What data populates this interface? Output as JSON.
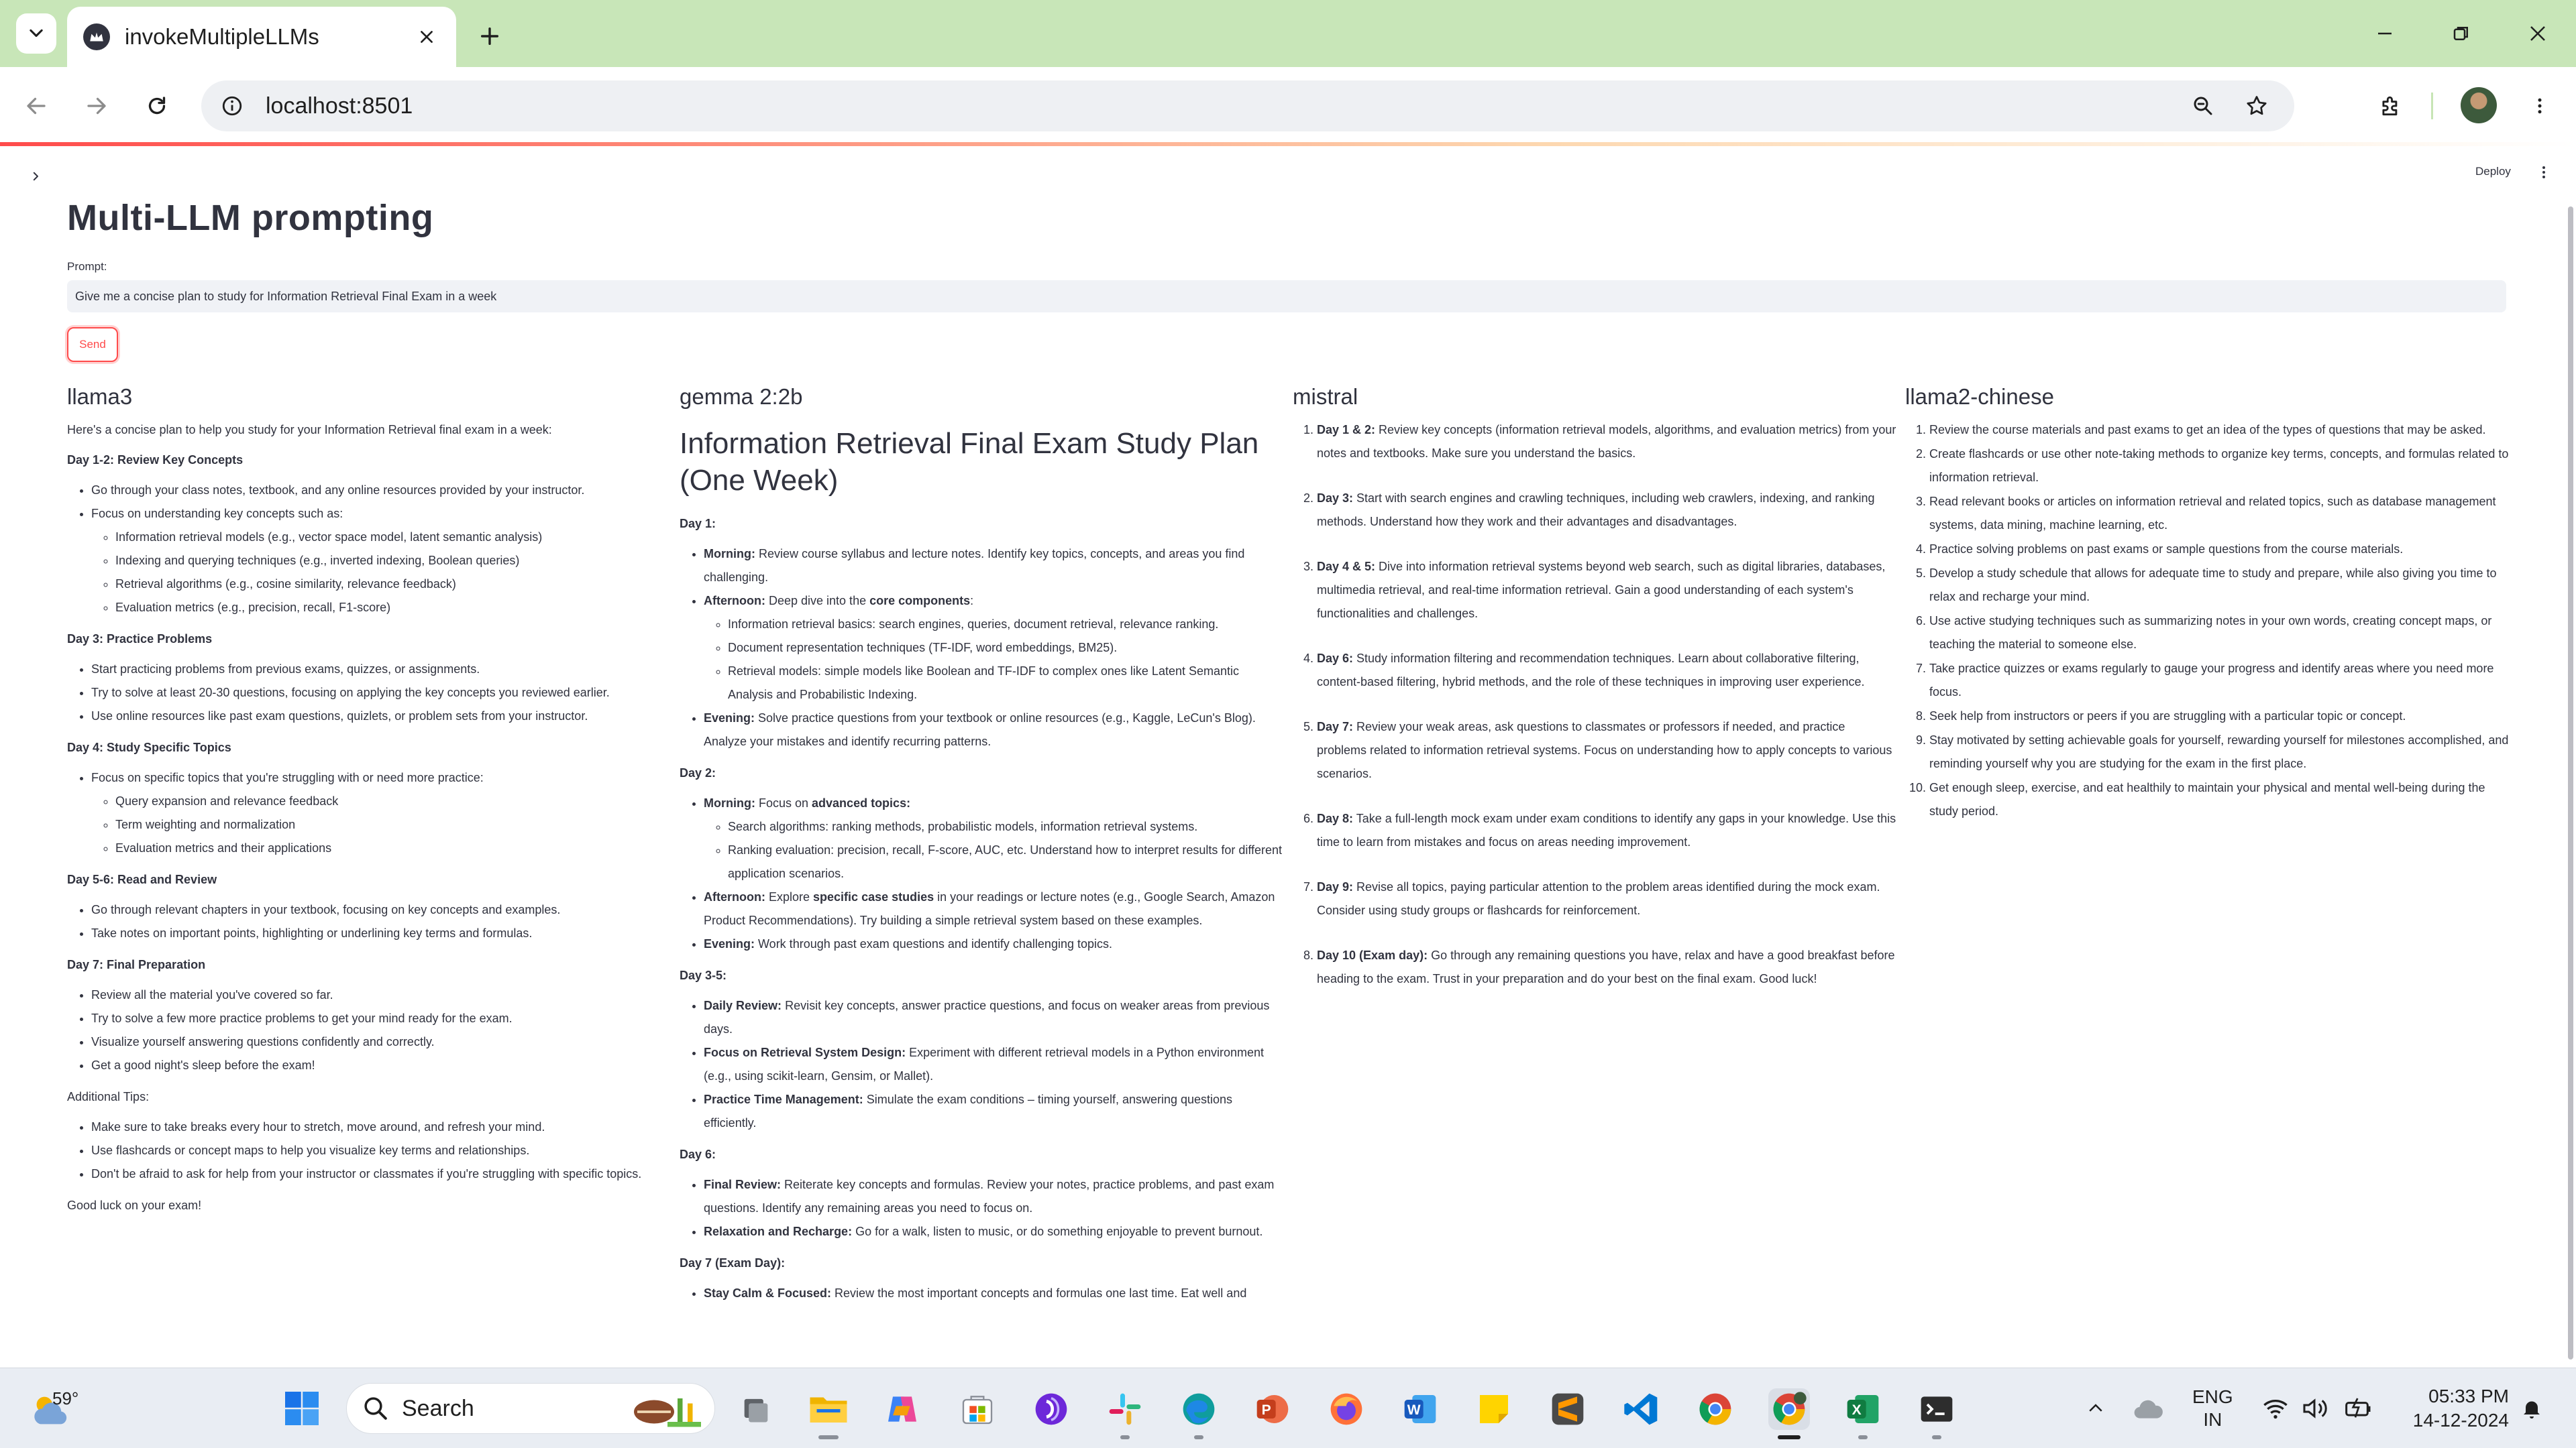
{
  "browser": {
    "tab_title": "invokeMultipleLLMs",
    "url": "localhost:8501"
  },
  "app": {
    "deploy_label": "Deploy",
    "title": "Multi-LLM prompting",
    "prompt_label": "Prompt:",
    "prompt_value": "Give me a concise plan to study for Information Retrieval Final Exam in a week",
    "send_label": "Send",
    "accent_color": "#ff4b4b"
  },
  "llama3": {
    "heading": "llama3",
    "intro": "Here's a concise plan to help you study for your Information Retrieval final exam in a week:",
    "day12": {
      "title": "Day 1-2: Review Key Concepts",
      "item1": "Go through your class notes, textbook, and any online resources provided by your instructor.",
      "item2": "Focus on understanding key concepts such as:",
      "sub": [
        "Information retrieval models (e.g., vector space model, latent semantic analysis)",
        "Indexing and querying techniques (e.g., inverted indexing, Boolean queries)",
        "Retrieval algorithms (e.g., cosine similarity, relevance feedback)",
        "Evaluation metrics (e.g., precision, recall, F1-score)"
      ]
    },
    "day3": {
      "title": "Day 3: Practice Problems",
      "items": [
        "Start practicing problems from previous exams, quizzes, or assignments.",
        "Try to solve at least 20-30 questions, focusing on applying the key concepts you reviewed earlier.",
        "Use online resources like past exam questions, quizlets, or problem sets from your instructor."
      ]
    },
    "day4": {
      "title": "Day 4: Study Specific Topics",
      "item1": "Focus on specific topics that you're struggling with or need more practice:",
      "sub": [
        "Query expansion and relevance feedback",
        "Term weighting and normalization",
        "Evaluation metrics and their applications"
      ]
    },
    "day56": {
      "title": "Day 5-6: Read and Review",
      "items": [
        "Go through relevant chapters in your textbook, focusing on key concepts and examples.",
        "Take notes on important points, highlighting or underlining key terms and formulas."
      ]
    },
    "day7": {
      "title": "Day 7: Final Preparation",
      "items": [
        "Review all the material you've covered so far.",
        "Try to solve a few more practice problems to get your mind ready for the exam.",
        "Visualize yourself answering questions confidently and correctly.",
        "Get a good night's sleep before the exam!"
      ]
    },
    "tips_title": "Additional Tips:",
    "tips": [
      "Make sure to take breaks every hour to stretch, move around, and refresh your mind.",
      "Use flashcards or concept maps to help you visualize key terms and relationships.",
      "Don't be afraid to ask for help from your instructor or classmates if you're struggling with specific topics."
    ],
    "closing": "Good luck on your exam!"
  },
  "gemma": {
    "heading": "gemma 2:2b",
    "plan_title": "Information Retrieval Final Exam Study Plan (One Week)",
    "day1_label": "Day 1:",
    "morning_label": "Morning:",
    "morning_text": " Review course syllabus and lecture notes. Identify key topics, concepts, and areas you find challenging.",
    "afternoon_label": "Afternoon:",
    "afternoon_pre": " Deep dive into the ",
    "afternoon_bold": "core components",
    "afternoon_post": ":",
    "afternoon_sub": [
      "Information retrieval basics: search engines, queries, document retrieval, relevance ranking.",
      "Document representation techniques (TF-IDF, word embeddings, BM25).",
      "Retrieval models: simple models like Boolean and TF-IDF to complex ones like Latent Semantic Analysis and Probabilistic Indexing."
    ],
    "evening_label": "Evening:",
    "evening_text": " Solve practice questions from your textbook or online resources (e.g., Kaggle, LeCun's Blog). Analyze your mistakes and identify recurring patterns.",
    "day2_label": "Day 2:",
    "d2_morning_pre": " Focus on ",
    "d2_morning_bold": "advanced topics:",
    "d2_morning_sub": [
      "Search algorithms: ranking methods, probabilistic models, information retrieval systems.",
      "Ranking evaluation: precision, recall, F-score, AUC, etc. Understand how to interpret results for different application scenarios."
    ],
    "d2_afternoon_pre": " Explore ",
    "d2_afternoon_bold": "specific case studies",
    "d2_afternoon_post": " in your readings or lecture notes (e.g., Google Search, Amazon Product Recommendations). Try building a simple retrieval system based on these examples.",
    "d2_evening_text": " Work through past exam questions and identify challenging topics.",
    "day35_label": "Day 3-5:",
    "daily_review_label": "Daily Review:",
    "daily_review_text": " Revisit key concepts, answer practice questions, and focus on weaker areas from previous days.",
    "focus_label": "Focus on Retrieval System Design:",
    "focus_text": " Experiment with different retrieval models in a Python environment (e.g., using scikit-learn, Gensim, or Mallet).",
    "ptm_label": "Practice Time Management:",
    "ptm_text": " Simulate the exam conditions – timing yourself, answering questions efficiently.",
    "day6_label": "Day 6:",
    "final_review_label": "Final Review:",
    "final_review_text": " Reiterate key concepts and formulas. Review your notes, practice problems, and past exam questions. Identify any remaining areas you need to focus on.",
    "relax_label": "Relaxation and Recharge:",
    "relax_text": " Go for a walk, listen to music, or do something enjoyable to prevent burnout.",
    "day7_label": "Day 7 (Exam Day):",
    "calm_label": "Stay Calm & Focused:",
    "calm_text": " Review the most important concepts and formulas one last time. Eat well and"
  },
  "mistral": {
    "heading": "mistral",
    "items": [
      {
        "label": "Day 1 & 2:",
        "text": " Review key concepts (information retrieval models, algorithms, and evaluation metrics) from your notes and textbooks. Make sure you understand the basics."
      },
      {
        "label": "Day 3:",
        "text": " Start with search engines and crawling techniques, including web crawlers, indexing, and ranking methods. Understand how they work and their advantages and disadvantages."
      },
      {
        "label": "Day 4 & 5:",
        "text": " Dive into information retrieval systems beyond web search, such as digital libraries, databases, multimedia retrieval, and real-time information retrieval. Gain a good understanding of each system's functionalities and challenges."
      },
      {
        "label": "Day 6:",
        "text": " Study information filtering and recommendation techniques. Learn about collaborative filtering, content-based filtering, hybrid methods, and the role of these techniques in improving user experience."
      },
      {
        "label": "Day 7:",
        "text": " Review your weak areas, ask questions to classmates or professors if needed, and practice problems related to information retrieval systems. Focus on understanding how to apply concepts to various scenarios."
      },
      {
        "label": "Day 8:",
        "text": " Take a full-length mock exam under exam conditions to identify any gaps in your knowledge. Use this time to learn from mistakes and focus on areas needing improvement."
      },
      {
        "label": "Day 9:",
        "text": " Revise all topics, paying particular attention to the problem areas identified during the mock exam. Consider using study groups or flashcards for reinforcement."
      },
      {
        "label": "Day 10 (Exam day):",
        "text": " Go through any remaining questions you have, relax and have a good breakfast before heading to the exam. Trust in your preparation and do your best on the final exam. Good luck!"
      }
    ]
  },
  "llama2_chinese": {
    "heading": "llama2-chinese",
    "items": [
      "Review the course materials and past exams to get an idea of the types of questions that may be asked.",
      "Create flashcards or use other note-taking methods to organize key terms, concepts, and formulas related to information retrieval.",
      "Read relevant books or articles on information retrieval and related topics, such as database management systems, data mining, machine learning, etc.",
      "Practice solving problems on past exams or sample questions from the course materials.",
      "Develop a study schedule that allows for adequate time to study and prepare, while also giving you time to relax and recharge your mind.",
      "Use active studying techniques such as summarizing notes in your own words, creating concept maps, or teaching the material to someone else.",
      "Take practice quizzes or exams regularly to gauge your progress and identify areas where you need more focus.",
      "Seek help from instructors or peers if you are struggling with a particular topic or concept.",
      "Stay motivated by setting achievable goals for yourself, rewarding yourself for milestones accomplished, and reminding yourself why you are studying for the exam in the first place.",
      "Get enough sleep, exercise, and eat healthily to maintain your physical and mental well-being during the study period."
    ]
  },
  "taskbar": {
    "temperature": "59°",
    "search_placeholder": "Search",
    "lang_line1": "ENG",
    "lang_line2": "IN",
    "time": "05:33 PM",
    "date": "14-12-2024"
  }
}
